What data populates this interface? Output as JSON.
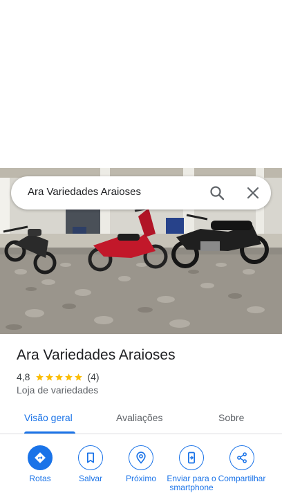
{
  "search": {
    "query": "Ara Variedades Araioses",
    "search_icon": "search-icon",
    "close_icon": "close-icon"
  },
  "place": {
    "name": "Ara Variedades Araioses",
    "rating": "4,8",
    "stars": 4.8,
    "review_count": "(4)",
    "category": "Loja de variedades"
  },
  "tabs": [
    {
      "label": "Visão geral",
      "active": true
    },
    {
      "label": "Avaliações",
      "active": false
    },
    {
      "label": "Sobre",
      "active": false
    }
  ],
  "actions": [
    {
      "label": "Rotas",
      "icon": "directions-icon"
    },
    {
      "label": "Salvar",
      "icon": "bookmark-icon"
    },
    {
      "label": "Próximo",
      "icon": "nearby-icon"
    },
    {
      "label": "Enviar para o smartphone",
      "icon": "send-to-phone-icon"
    },
    {
      "label": "Compartilhar",
      "icon": "share-icon"
    }
  ],
  "colors": {
    "accent": "#1a73e8",
    "star": "#fbbc04",
    "text_primary": "#202124",
    "text_secondary": "#5f6368"
  }
}
